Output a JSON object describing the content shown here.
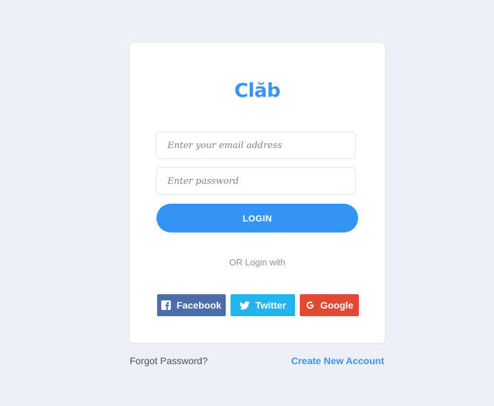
{
  "brand": {
    "logo_text": "Clăb",
    "color": "#3a94f0"
  },
  "form": {
    "email_placeholder": "Enter your email address",
    "email_value": "",
    "password_placeholder": "Enter password",
    "password_value": "",
    "login_label": "LOGIN",
    "login_color": "#3494f4"
  },
  "social": {
    "divider_text": "OR Login with",
    "buttons": [
      {
        "label": "Facebook",
        "icon": "facebook-icon",
        "color": "#4a6ea9"
      },
      {
        "label": "Twitter",
        "icon": "twitter-icon",
        "color": "#24b3ec"
      },
      {
        "label": "Google",
        "icon": "google-icon",
        "color": "#df4a32"
      }
    ]
  },
  "footer": {
    "forgot_label": "Forgot Password?",
    "create_label": "Create New Account"
  }
}
